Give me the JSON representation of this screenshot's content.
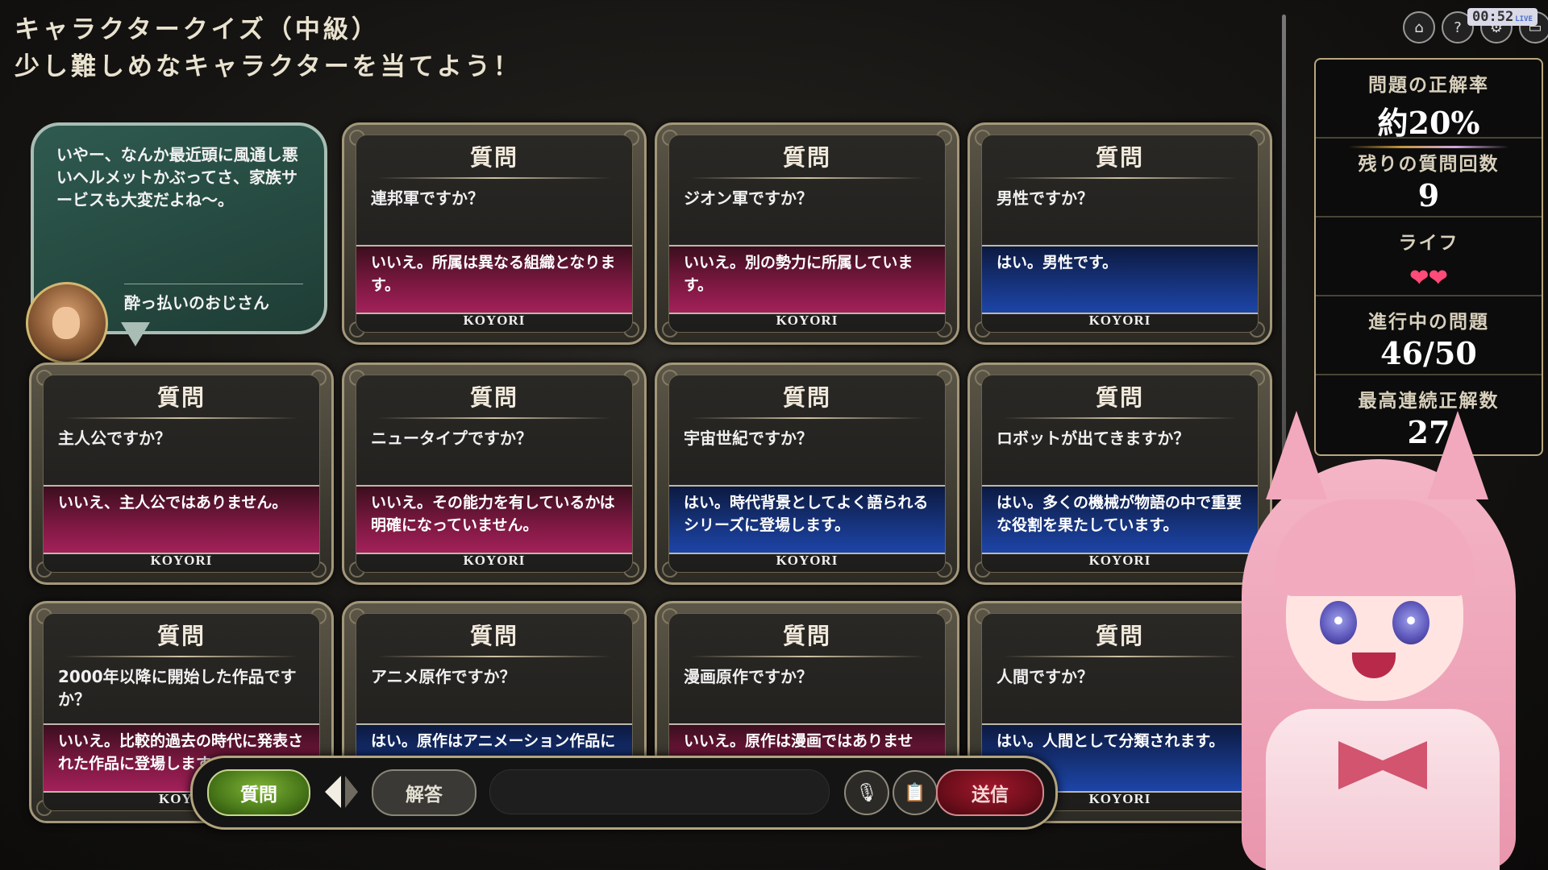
{
  "header": {
    "title_line1": "キャラクタークイズ（中級）",
    "title_line2": "少し難しめなキャラクターを当てよう！"
  },
  "timer": {
    "time": "00:52",
    "live": "LIVE"
  },
  "top_icons": [
    "home-icon",
    "help-icon",
    "settings-icon",
    "window-icon"
  ],
  "stats": {
    "accuracy_label": "問題の正解率",
    "accuracy_value": "約20%",
    "remaining_label": "残りの質問回数",
    "remaining_value": "9",
    "life_label": "ライフ",
    "life_count": 2,
    "progress_label": "進行中の問題",
    "progress_value": "46/50",
    "streak_label": "最高連続正解数",
    "streak_value": "27"
  },
  "npc": {
    "speech": "いやー、なんか最近頭に風通し悪いヘルメットかぶってさ、家族サービスも大変だよね～。",
    "name": "酔っ払いのおじさん"
  },
  "cards": [
    {
      "header": "質問",
      "question": "連邦軍ですか？",
      "answer": "いいえ。所属は異なる組織となります。",
      "result": "no",
      "signature": "KOYORI"
    },
    {
      "header": "質問",
      "question": "ジオン軍ですか？",
      "answer": "いいえ。別の勢力に所属しています。",
      "result": "no",
      "signature": "KOYORI"
    },
    {
      "header": "質問",
      "question": "男性ですか？",
      "answer": "はい。男性です。",
      "result": "yes",
      "signature": "KOYORI"
    },
    {
      "header": "質問",
      "question": "主人公ですか？",
      "answer": "いいえ、主人公ではありません。",
      "result": "no",
      "signature": "KOYORI"
    },
    {
      "header": "質問",
      "question": "ニュータイプですか？",
      "answer": "いいえ。その能力を有しているかは明確になっていません。",
      "result": "no",
      "signature": "KOYORI"
    },
    {
      "header": "質問",
      "question": "宇宙世紀ですか？",
      "answer": "はい。時代背景としてよく語られるシリーズに登場します。",
      "result": "yes",
      "signature": "KOYORI"
    },
    {
      "header": "質問",
      "question": "ロボットが出てきますか？",
      "answer": "はい。多くの機械が物語の中で重要な役割を果たしています。",
      "result": "yes",
      "signature": "KOYORI"
    },
    {
      "header": "質問",
      "question": "2000年以降に開始した作品ですか？",
      "answer": "いいえ。比較的過去の時代に発表された作品に登場します。",
      "result": "no",
      "signature": "KOYO"
    },
    {
      "header": "質問",
      "question": "アニメ原作ですか？",
      "answer": "はい。原作はアニメーション作品にあたります。",
      "result": "yes",
      "signature": ""
    },
    {
      "header": "質問",
      "question": "漫画原作ですか？",
      "answer": "いいえ。原作は漫画ではありません。",
      "result": "no",
      "signature": ""
    },
    {
      "header": "質問",
      "question": "人間ですか？",
      "answer": "はい。人間として分類されます。",
      "result": "yes",
      "signature": "KOYORI"
    }
  ],
  "controls": {
    "question_button": "質問",
    "answer_button": "解答",
    "send_button": "送信",
    "mic_icon": "mic-icon",
    "memo_icon": "memo-icon"
  },
  "colors": {
    "no_answer": "#8a1a4a",
    "yes_answer": "#1a3a8f",
    "question_active": "#5a8c22",
    "send": "#8a1224",
    "frame_gold": "#a4977a"
  }
}
